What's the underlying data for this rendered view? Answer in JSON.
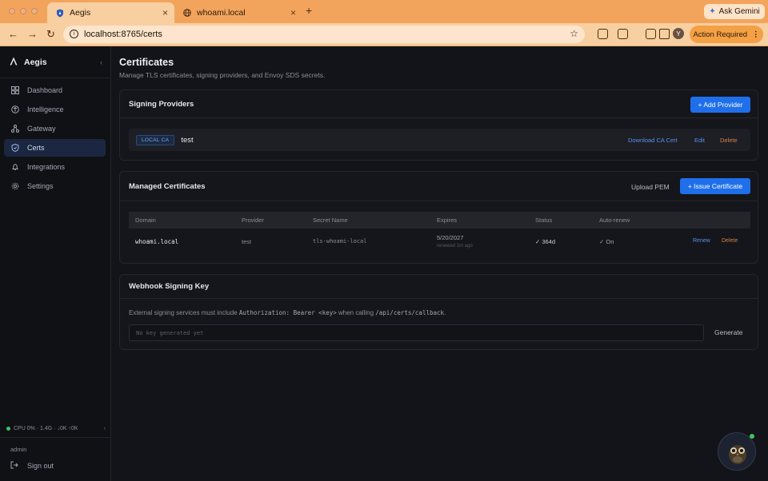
{
  "browser": {
    "tabs": [
      {
        "title": "Aegis",
        "active": true,
        "icon": "shield-icon"
      },
      {
        "title": "whoami.local",
        "active": false,
        "icon": "globe-icon"
      }
    ],
    "ask_gemini": "Ask Gemini",
    "url": "localhost:8765/certs",
    "profile_initial": "Y",
    "action_required": "Action Required"
  },
  "sidebar": {
    "brand": "Aegis",
    "items": [
      {
        "label": "Dashboard",
        "icon": "dashboard-icon",
        "active": false
      },
      {
        "label": "Intelligence",
        "icon": "intelligence-icon",
        "active": false
      },
      {
        "label": "Gateway",
        "icon": "gateway-icon",
        "active": false
      },
      {
        "label": "Certs",
        "icon": "shield-icon",
        "active": true
      },
      {
        "label": "Integrations",
        "icon": "bell-icon",
        "active": false
      },
      {
        "label": "Settings",
        "icon": "gear-icon",
        "active": false
      }
    ],
    "status": "CPU 0% · 1.4G · ↓0K ↑0K",
    "user": "admin",
    "signout": "Sign out"
  },
  "page": {
    "title": "Certificates",
    "subtitle": "Manage TLS certificates, signing providers, and Envoy SDS secrets."
  },
  "signing_providers": {
    "title": "Signing Providers",
    "add_button": "+ Add Provider",
    "providers": [
      {
        "badge": "LOCAL CA",
        "name": "test",
        "download": "Download CA Cert",
        "edit": "Edit",
        "delete": "Delete"
      }
    ]
  },
  "managed_certs": {
    "title": "Managed Certificates",
    "upload": "Upload PEM",
    "issue_button": "+ Issue Certificate",
    "columns": [
      "Domain",
      "Provider",
      "Secret Name",
      "Expires",
      "Status",
      "Auto-renew"
    ],
    "rows": [
      {
        "domain": "whoami.local",
        "provider": "test",
        "secret": "tls-whoami-local",
        "expires": "5/20/2027",
        "renewed": "renewed 1m ago",
        "status": "✓ 364d",
        "autorenew": "✓ On",
        "renew": "Renew",
        "delete": "Delete"
      }
    ]
  },
  "webhook": {
    "title": "Webhook Signing Key",
    "text_pre": "External signing services must include ",
    "text_code1": "Authorization: Bearer <key>",
    "text_mid": " when calling ",
    "text_code2": "/api/certs/callback",
    "text_post": ".",
    "placeholder": "No key generated yet",
    "generate": "Generate"
  },
  "colors": {
    "accent": "#1f6feb",
    "link": "#5b8ff0",
    "danger": "#d7803e",
    "success": "#4bbf6b",
    "browser_frame": "#f3a45c"
  }
}
